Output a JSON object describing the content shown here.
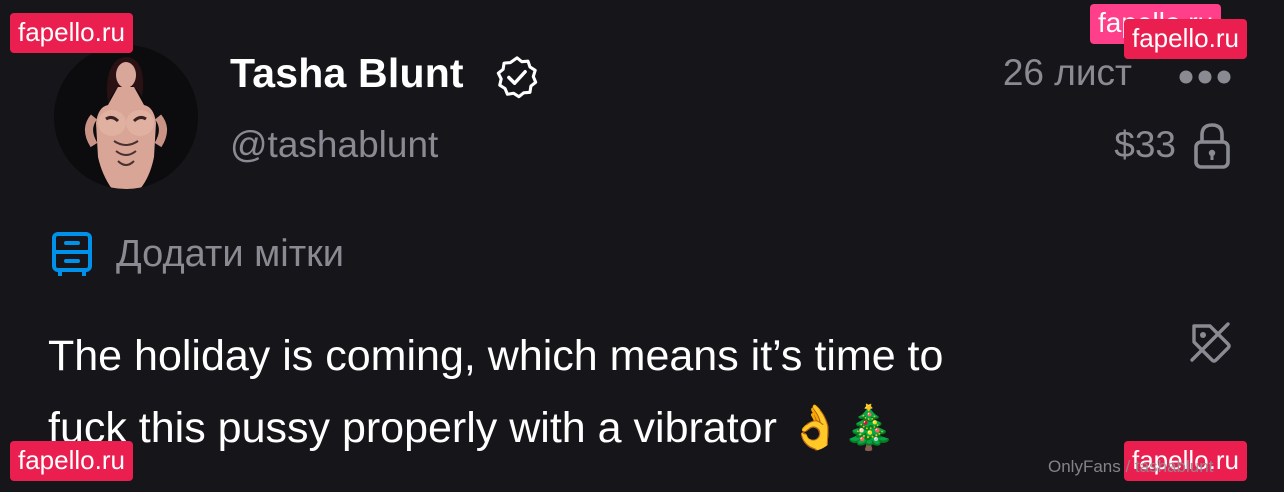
{
  "author": {
    "name": "Tasha Blunt",
    "username": "@tashablunt",
    "verified_icon": "verified-badge-icon",
    "avatar": "profile-avatar"
  },
  "post_meta": {
    "date": "26 лист",
    "price": "$33",
    "lock_icon": "lock-icon",
    "more_icon": "more-dots-icon"
  },
  "tags": {
    "icon": "tag-collection-icon",
    "label": "Додати мітки"
  },
  "post": {
    "text_line1": "The holiday is coming, which means it’s time to",
    "text_line2": "fuck this pussy properly with a vibrator",
    "emojis": "👌🎄",
    "hide_icon": "tag-off-icon"
  },
  "watermarks": {
    "top_left": "fapello.ru",
    "top_right_back": "fapello.ru",
    "top_right": "fapello.ru",
    "bottom_left": "fapello.ru",
    "bottom_right": "fapello.ru",
    "site_mark": "OnlyFans / tashablunt"
  },
  "colors": {
    "background": "#16161a",
    "primary_text": "#ffffff",
    "secondary_text": "#8a8a92",
    "accent": "#0091ea",
    "watermark": "#ea1f4f"
  }
}
